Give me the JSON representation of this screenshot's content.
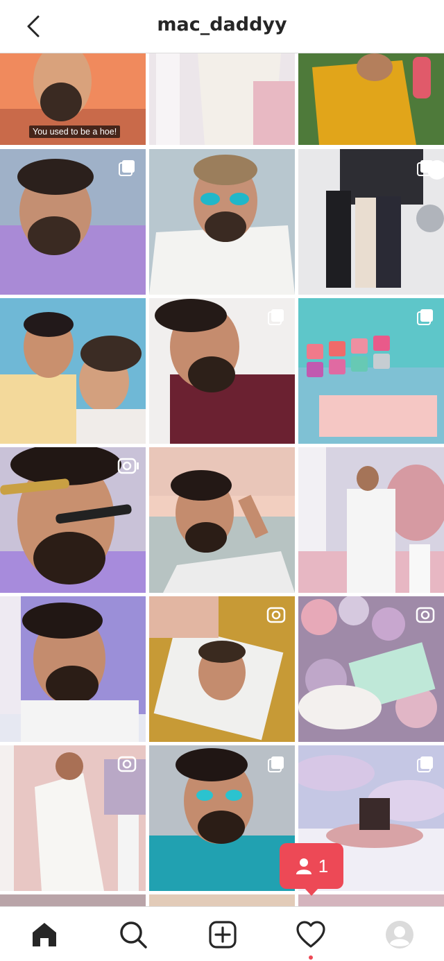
{
  "header": {
    "title": "mac_daddyy"
  },
  "posts": {
    "first_caption": "You used to be a hoe!",
    "tiles": [
      {
        "label": "post-1",
        "type": "photo"
      },
      {
        "label": "post-2",
        "type": "photo"
      },
      {
        "label": "post-3",
        "type": "photo"
      },
      {
        "label": "post-4",
        "type": "carousel"
      },
      {
        "label": "post-5",
        "type": "carousel"
      },
      {
        "label": "post-6",
        "type": "carousel"
      },
      {
        "label": "post-7",
        "type": "photo"
      },
      {
        "label": "post-8",
        "type": "carousel"
      },
      {
        "label": "post-9",
        "type": "carousel"
      },
      {
        "label": "post-10",
        "type": "video"
      },
      {
        "label": "post-11",
        "type": "photo"
      },
      {
        "label": "post-12",
        "type": "photo"
      },
      {
        "label": "post-13",
        "type": "photo"
      },
      {
        "label": "post-14",
        "type": "video"
      },
      {
        "label": "post-15",
        "type": "video"
      },
      {
        "label": "post-16",
        "type": "video"
      },
      {
        "label": "post-17",
        "type": "carousel"
      },
      {
        "label": "post-18",
        "type": "carousel"
      }
    ]
  },
  "activity": {
    "count": "1"
  },
  "nav": {
    "items": [
      "home-icon",
      "search-icon",
      "new-post-icon",
      "activity-heart-icon",
      "profile-avatar"
    ]
  }
}
